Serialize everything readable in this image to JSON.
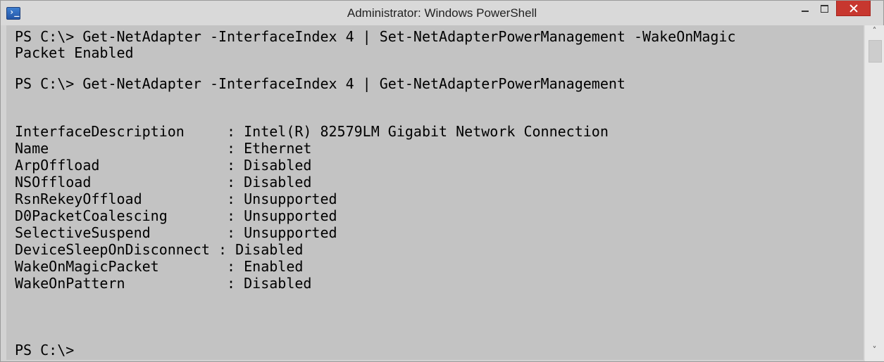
{
  "window": {
    "title": "Administrator: Windows PowerShell",
    "app_icon": "powershell-icon",
    "app_icon_glyph": "›_",
    "controls": {
      "minimize_icon": "minimize-icon",
      "maximize_icon": "maximize-icon",
      "close_icon": "close-icon",
      "close_color": "#c7372f"
    }
  },
  "console": {
    "background": "#c3c3c3",
    "foreground": "#000000",
    "lines": [
      "PS C:\\> Get-NetAdapter -InterfaceIndex 4 | Set-NetAdapterPowerManagement -WakeOnMagic",
      "Packet Enabled",
      "PS C:\\> Get-NetAdapter -InterfaceIndex 4 | Get-NetAdapterPowerManagement",
      "",
      "",
      "InterfaceDescription     : Intel(R) 82579LM Gigabit Network Connection",
      "Name                     : Ethernet",
      "ArpOffload               : Disabled",
      "NSOffload                : Disabled",
      "RsnRekeyOffload          : Unsupported",
      "D0PacketCoalescing       : Unsupported",
      "SelectiveSuspend         : Unsupported",
      "DeviceSleepOnDisconnect : Disabled",
      "WakeOnMagicPacket        : Enabled",
      "WakeOnPattern            : Disabled",
      "",
      "",
      "",
      "PS C:\\>"
    ]
  },
  "scrollbar": {
    "up_icon": "scroll-up-arrow-icon",
    "down_icon": "scroll-down-arrow-icon",
    "up_glyph": "˄",
    "down_glyph": "˅"
  }
}
